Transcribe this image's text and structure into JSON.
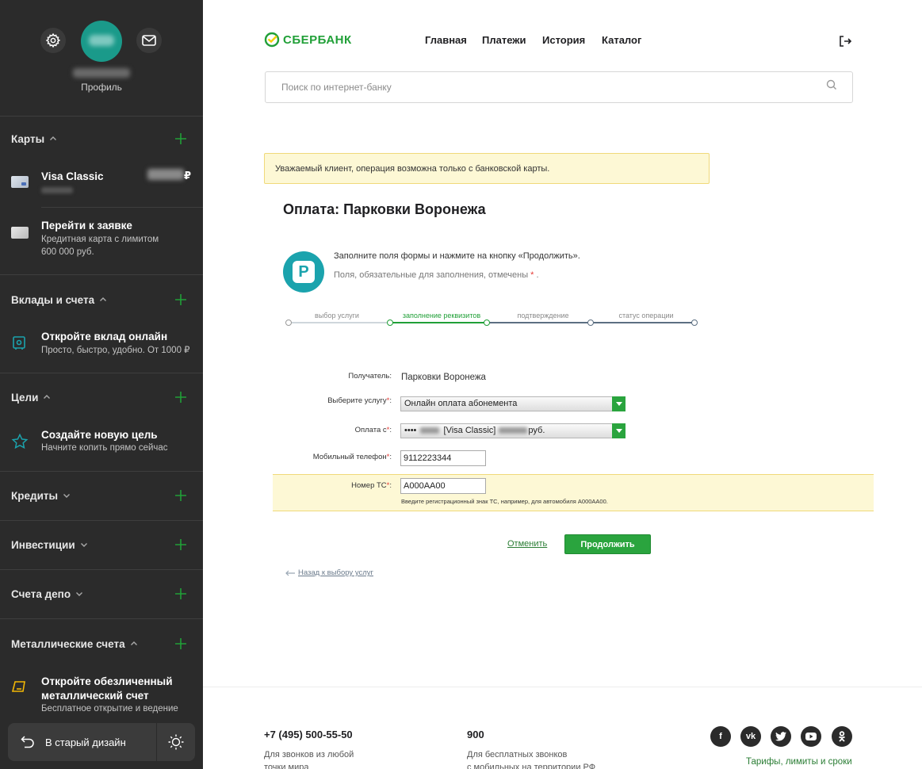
{
  "sidebar": {
    "profile_label": "Профиль",
    "sections": {
      "cards": {
        "label": "Карты"
      },
      "deposits": {
        "label": "Вклады и счета"
      },
      "goals": {
        "label": "Цели"
      },
      "credits": {
        "label": "Кредиты"
      },
      "investments": {
        "label": "Инвестиции"
      },
      "depo": {
        "label": "Счета депо"
      },
      "metal": {
        "label": "Металлические счета"
      }
    },
    "items": {
      "visa": {
        "title": "Visa Classic",
        "currency": "₽"
      },
      "application": {
        "title": "Перейти к заявке",
        "sub1": "Кредитная карта с лимитом",
        "sub2": "600 000 руб."
      },
      "open_deposit": {
        "title": "Откройте вклад онлайн",
        "sub": "Просто, быстро, удобно. От 1000 ₽"
      },
      "new_goal": {
        "title": "Создайте новую цель",
        "sub": "Начните копить прямо сейчас"
      },
      "metal_account": {
        "title1": "Откройте обезличенный",
        "title2": "металлический счет",
        "sub": "Бесплатное открытие и ведение"
      }
    },
    "old_design_label": "В старый дизайн"
  },
  "header": {
    "logo_text": "СБЕРБАНК",
    "nav": [
      "Главная",
      "Платежи",
      "История",
      "Каталог"
    ],
    "search_placeholder": "Поиск по интернет-банку"
  },
  "notice": "Уважаемый клиент, операция возможна только с банковской карты.",
  "page_title": "Оплата: Парковки Воронежа",
  "instructions": {
    "line1": "Заполните поля формы и нажмите на кнопку «Продолжить».",
    "line2": "Поля, обязательные для заполнения, отмечены",
    "star": "*",
    "dot": "."
  },
  "steps": [
    "выбор услуги",
    "заполнение реквизитов",
    "подтверждение",
    "статус операции"
  ],
  "form": {
    "recipient_label": "Получатель:",
    "recipient_value": "Парковки Воронежа",
    "service_label": "Выберите услугу",
    "service_value": "Онлайн оплата абонемента",
    "payfrom_label": "Оплата с",
    "payfrom_prefix": "••••",
    "payfrom_card": "[Visa Classic]",
    "payfrom_suffix": "руб.",
    "phone_label": "Мобильный телефон",
    "phone_value": "9112223344",
    "plate_label": "Номер ТС",
    "plate_value": "А000АА00",
    "plate_hint": "Введите регистрационный знак ТС, например, для автомобиля А000АА00.",
    "req_mark": "*",
    "colon": ":"
  },
  "actions": {
    "cancel": "Отменить",
    "continue": "Продолжить",
    "back": "Назад к выбору услуг"
  },
  "footer": {
    "phone1": "+7 (495) 500-55-50",
    "phone1_desc1": "Для звонков из любой",
    "phone1_desc2": "точки мира",
    "phone2": "900",
    "phone2_desc1": "Для бесплатных звонков",
    "phone2_desc2": "с мобильных на территории РФ",
    "tariffs": "Тарифы, лимиты и сроки"
  },
  "colors": {
    "brand": "#21a038",
    "sidebar_bg": "#2b2b2b",
    "accent_teal": "#1ba3ad",
    "notice_bg": "#fdf8d5"
  }
}
